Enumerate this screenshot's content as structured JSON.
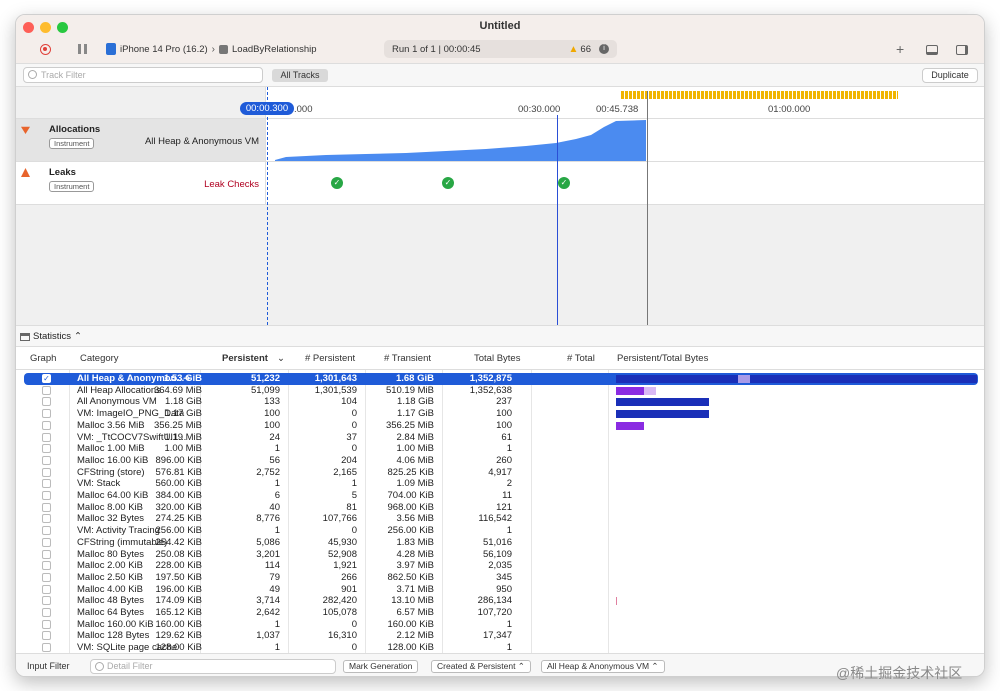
{
  "window": {
    "title": "Untitled"
  },
  "toolbar": {
    "device": "iPhone 14 Pro (16.2)",
    "target": "LoadByRelationship",
    "run_status": "Run 1 of 1  |  00:00:45",
    "warning_count": "66",
    "add_label": "+"
  },
  "filterbar": {
    "track_filter_placeholder": "Track Filter",
    "all_tracks": "All Tracks",
    "duplicate": "Duplicate"
  },
  "timeline": {
    "current_time": "00:00.300",
    "ticks": [
      ".000",
      "00:30.000",
      "00:45.738",
      "01:00.000"
    ],
    "tracks": [
      {
        "name": "Allocations",
        "badge": "Instrument",
        "detail": "All Heap & Anonymous VM",
        "color": "#e8642c"
      },
      {
        "name": "Leaks",
        "badge": "Instrument",
        "detail": "Leak Checks",
        "color": "#e8642c"
      }
    ]
  },
  "stats": {
    "label": "Statistics"
  },
  "table": {
    "headers": [
      "Graph",
      "Category",
      "Persistent",
      "# Persistent",
      "# Transient",
      "Total Bytes",
      "# Total",
      "Persistent/Total Bytes"
    ],
    "rows": [
      [
        "All Heap & Anonymou...",
        "1.53 GiB",
        "51,232",
        "1,301,643",
        "1.68 GiB",
        "1,352,875"
      ],
      [
        "All Heap Allocations",
        "364.69 MiB",
        "51,099",
        "1,301,539",
        "510.19 MiB",
        "1,352,638"
      ],
      [
        "All Anonymous VM",
        "1.18 GiB",
        "133",
        "104",
        "1.18 GiB",
        "237"
      ],
      [
        "VM: ImageIO_PNG_Data",
        "1.17 GiB",
        "100",
        "0",
        "1.17 GiB",
        "100"
      ],
      [
        "Malloc 3.56 MiB",
        "356.25 MiB",
        "100",
        "0",
        "356.25 MiB",
        "100"
      ],
      [
        "VM: _TtCOCV7SwiftUI1...",
        "1.19 MiB",
        "24",
        "37",
        "2.84 MiB",
        "61"
      ],
      [
        "Malloc 1.00 MiB",
        "1.00 MiB",
        "1",
        "0",
        "1.00 MiB",
        "1"
      ],
      [
        "Malloc 16.00 KiB",
        "896.00 KiB",
        "56",
        "204",
        "4.06 MiB",
        "260"
      ],
      [
        "CFString (store)",
        "576.81 KiB",
        "2,752",
        "2,165",
        "825.25 KiB",
        "4,917"
      ],
      [
        "VM: Stack",
        "560.00 KiB",
        "1",
        "1",
        "1.09 MiB",
        "2"
      ],
      [
        "Malloc 64.00 KiB",
        "384.00 KiB",
        "6",
        "5",
        "704.00 KiB",
        "11"
      ],
      [
        "Malloc 8.00 KiB",
        "320.00 KiB",
        "40",
        "81",
        "968.00 KiB",
        "121"
      ],
      [
        "Malloc 32 Bytes",
        "274.25 KiB",
        "8,776",
        "107,766",
        "3.56 MiB",
        "116,542"
      ],
      [
        "VM: Activity Tracing",
        "256.00 KiB",
        "1",
        "0",
        "256.00 KiB",
        "1"
      ],
      [
        "CFString (immutable)",
        "254.42 KiB",
        "5,086",
        "45,930",
        "1.83 MiB",
        "51,016"
      ],
      [
        "Malloc 80 Bytes",
        "250.08 KiB",
        "3,201",
        "52,908",
        "4.28 MiB",
        "56,109"
      ],
      [
        "Malloc 2.00 KiB",
        "228.00 KiB",
        "114",
        "1,921",
        "3.97 MiB",
        "2,035"
      ],
      [
        "Malloc 2.50 KiB",
        "197.50 KiB",
        "79",
        "266",
        "862.50 KiB",
        "345"
      ],
      [
        "Malloc 4.00 KiB",
        "196.00 KiB",
        "49",
        "901",
        "3.71 MiB",
        "950"
      ],
      [
        "Malloc 48 Bytes",
        "174.09 KiB",
        "3,714",
        "282,420",
        "13.10 MiB",
        "286,134"
      ],
      [
        "Malloc 64 Bytes",
        "165.12 KiB",
        "2,642",
        "105,078",
        "6.57 MiB",
        "107,720"
      ],
      [
        "Malloc 160.00 KiB",
        "160.00 KiB",
        "1",
        "0",
        "160.00 KiB",
        "1"
      ],
      [
        "Malloc 128 Bytes",
        "129.62 KiB",
        "1,037",
        "16,310",
        "2.12 MiB",
        "17,347"
      ],
      [
        "VM: SQLite page cache",
        "128.00 KiB",
        "1",
        "0",
        "128.00 KiB",
        "1"
      ]
    ]
  },
  "bottom": {
    "input_filter": "Input Filter",
    "detail_filter_placeholder": "Detail Filter",
    "mark_generation": "Mark Generation",
    "created_persistent": "Created & Persistent",
    "heap_select": "All Heap & Anonymous VM"
  },
  "watermark": "@稀土掘金技术社区"
}
